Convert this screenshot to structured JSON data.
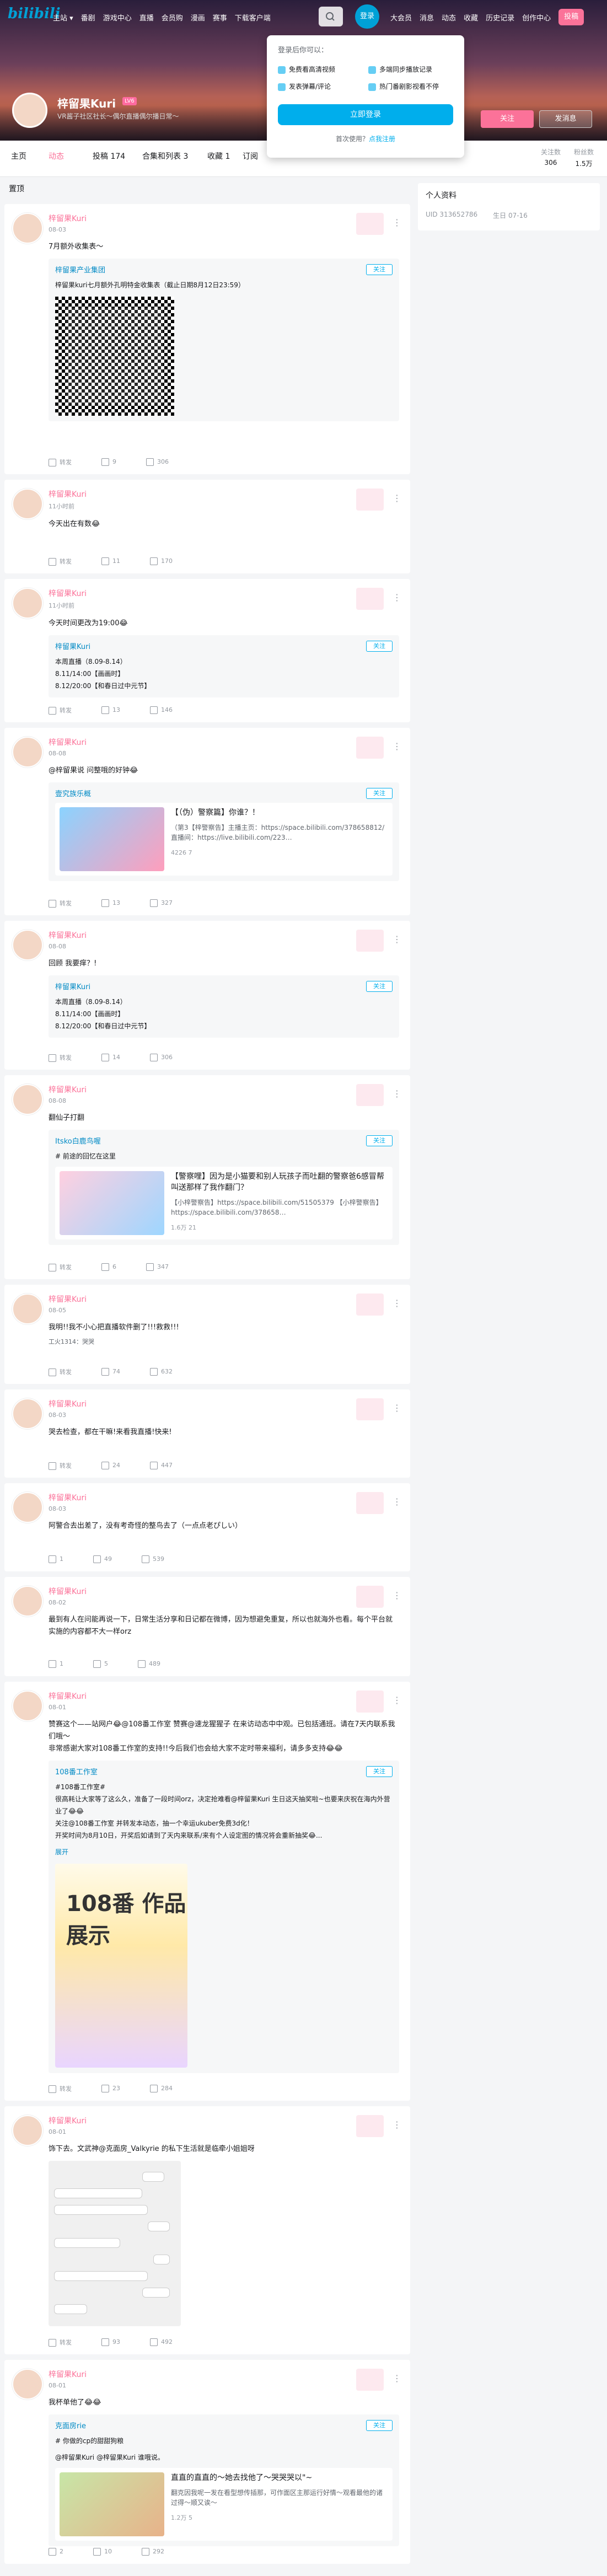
{
  "nav": {
    "logo": "bilibili",
    "links": [
      "主站 ▾",
      "番剧",
      "游戏中心",
      "直播",
      "会员购",
      "漫画",
      "赛事",
      "下载客户端"
    ],
    "login": "登录",
    "right": [
      "大会员",
      "消息",
      "动态",
      "收藏",
      "历史记录",
      "创作中心",
      "投稿"
    ]
  },
  "popup": {
    "title": "登录后你可以：",
    "features": [
      "免费看高清视频",
      "多端同步播放记录",
      "发表弹幕/评论",
      "热门番剧影视看不停"
    ],
    "login_btn": "立即登录",
    "register_text": "首次使用？",
    "register_link": "点我注册"
  },
  "profile": {
    "name": "梓留果Kuri",
    "level": "LV6",
    "sign": "VR酱子社区社长～偶尔直播偶尔播日常～",
    "follow": "关注",
    "message": "发消息"
  },
  "tabs": {
    "items": [
      "主页",
      "动态",
      "投稿 174",
      "合集和列表 3",
      "收藏 1",
      "订阅"
    ],
    "stats": [
      {
        "label": "关注数",
        "value": "306"
      },
      {
        "label": "粉丝数",
        "value": "1.5万"
      }
    ]
  },
  "main_label": "置顶",
  "side": {
    "title": "个人资料",
    "uid_label": "UID",
    "uid": "313652786",
    "bday_label": "生日",
    "bday": "07-16"
  },
  "posts": [
    {
      "name": "梓留果Kuri",
      "time": "08-03",
      "text": "7月额外收集表～",
      "fwd_name": "梓留果产业集团",
      "fwd_text": "梓留果kuri七月额外孔明特金收集表（截止日期8月12日23:59）",
      "stats": [
        "转发",
        "9",
        "306"
      ]
    },
    {
      "name": "梓留果Kuri",
      "time": "11小时前",
      "text": "今天出在有数😂",
      "stats": [
        "转发",
        "11",
        "170"
      ]
    },
    {
      "name": "梓留果Kuri",
      "time": "11小时前",
      "text": "今天时间更改为19:00😂",
      "fwd_name": "梓留果Kuri",
      "fwd_text": "本周直播（8.09-8.14）\n8.11/14:00【画画时】\n8.12/20:00【和春日过中元节】",
      "stats": [
        "转发",
        "13",
        "146"
      ]
    },
    {
      "name": "梓留果Kuri",
      "time": "08-08",
      "text": "@梓留果说 问整哦的好钟😂",
      "fwd_name": "壹究族乐概",
      "fwd_text": "【（伪）警察篇】你谁？！",
      "fwd_desc": "（第3【梓警察告】主播主页：https://space.bilibili.com/378658812/ 直播间：https://live.bilibili.com/223…",
      "fwd_stats": "4226  7",
      "stats": [
        "转发",
        "13",
        "327"
      ]
    },
    {
      "name": "梓留果Kuri",
      "time": "08-08",
      "text": "回顾 我要痒？!",
      "fwd_name": "梓留果Kuri",
      "fwd_text": "本周直播（8.09-8.14）\n8.11/14:00【画画时】\n8.12/20:00【和春日过中元节】",
      "stats": [
        "转发",
        "14",
        "306"
      ]
    },
    {
      "name": "梓留果Kuri",
      "time": "08-08",
      "text": "翻仙子打翻",
      "fwd_name": "Itsko白鹿鸟喔",
      "fwd_tag": "# 前途的回忆在这里",
      "fwd_text": "【警察哩】因为是小猫要和别人玩孩子而吐翻的警察爸6感冒帮叫送那样了我作翻门？",
      "fwd_desc": "【小梓警察告】https://space.bilibili.com/51505379 【小梓警察告】https://space.bilibili.com/378658…",
      "fwd_stats": "1.6万  21",
      "stats": [
        "转发",
        "6",
        "347"
      ]
    },
    {
      "name": "梓留果Kuri",
      "time": "08-05",
      "text": "我明!!我不小心把直播软件删了!!!救救!!!",
      "cmt": "工火1314：哭哭",
      "stats": [
        "转发",
        "74",
        "632"
      ]
    },
    {
      "name": "梓留果Kuri",
      "time": "08-03",
      "text": "哭去检查，都在干嘛!来看我直播!快来!",
      "stats": [
        "转发",
        "24",
        "447"
      ]
    },
    {
      "name": "梓留果Kuri",
      "time": "08-03",
      "text": "阿警合去出差了，没有考奇怪的整鸟去了（一点点老ぴしい）",
      "stats": [
        "1",
        "49",
        "539"
      ]
    },
    {
      "name": "梓留果Kuri",
      "time": "08-02",
      "text": "最到有人在问能再说一下，日常生活分享和日记都在微博，因为想避免重复，所以也就海外也看。每个平台就实施的内容都不大一样orz",
      "stats": [
        "1",
        "5",
        "489"
      ]
    },
    {
      "name": "梓留果Kuri",
      "time": "08-01",
      "text": "赞赛这个——站网户😂@108番工作室 赞赛@速龙猩猩子 在来访动态中中观。已包括通班。请在7天内联系我们哦～\n非常感谢大家对108番工作室的支持!!今后我们也会给大家不定时带来福利，请多多支持😂😂",
      "fwd_name": "108番工作室",
      "fwd_text": "#108番工作室#\n很高耗让大家等了这么久，准备了一段时间orz，决定抢难看@梓留果Kuri 生日这天抽奖啦~也要来庆祝在海内外营业了😂😂\n关注@108番工作室 并转发本动态，抽一个幸运ukuber免费3d化！\n开奖时间为8月10日，开奖后如请到了天内来联系/来有个人设定图的情况将会重新抽奖😂...",
      "fwd_more": "展开",
      "poster": "108番 作品展示",
      "stats": [
        "转发",
        "23",
        "284"
      ]
    },
    {
      "name": "梓留果Kuri",
      "time": "08-01",
      "text": "饰下去。文武神@克面房_Valkyrie 的私下生活就是临牵小姐姐呀",
      "stats": [
        "转发",
        "93",
        "492"
      ]
    },
    {
      "name": "梓留果Kuri",
      "time": "08-01",
      "text": "我杯单他了😂😂",
      "fwd_name": "克面房rie",
      "fwd_tag": "# 你做的cp的甜甜狗粮",
      "fwd_text": "@梓留果Kuri @梓留果Kuri 谁哦说。",
      "fwd_vt": "直直的直直的～她去找他了～哭哭哭以\"~",
      "fwd_desc": "翻克因我呢一发在看型想传插那，可作面区主那运行好情～观看最他的诸过得～顺又诶～",
      "fwd_stats": "1.2万  5",
      "stats": [
        "2",
        "10",
        "292"
      ]
    }
  ],
  "icons": [
    "search-icon",
    "more-icon",
    "forward-icon",
    "comment-icon",
    "like-icon"
  ],
  "colors": {
    "accent": "#fb7299",
    "link": "#00aeec"
  }
}
